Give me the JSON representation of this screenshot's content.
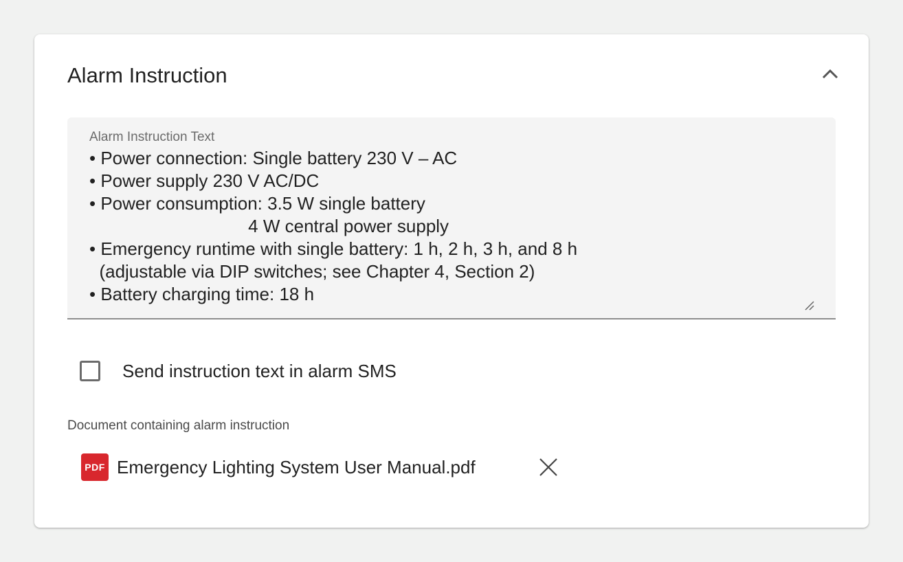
{
  "card": {
    "title": "Alarm Instruction",
    "collapse_icon": "chevron-up-icon"
  },
  "instruction": {
    "label": "Alarm Instruction Text",
    "lines": [
      "• Power connection: Single battery 230 V – AC",
      "• Power supply 230 V AC/DC",
      "• Power consumption: 3.5 W single battery",
      "                                4 W central power supply",
      "• Emergency runtime with single battery: 1 h, 2 h, 3 h, and 8 h",
      "  (adjustable via DIP switches; see Chapter 4, Section 2)",
      "• Battery charging time: 18 h"
    ],
    "resize_icon": "resize-handle-icon"
  },
  "sms_option": {
    "label": "Send instruction text in alarm SMS",
    "checked": false
  },
  "document": {
    "label": "Document containing alarm instruction",
    "file_icon_text": "PDF",
    "file_name": "Emergency Lighting System User Manual.pdf",
    "remove_icon": "close-icon"
  },
  "colors": {
    "pdf_icon": "#d8272d",
    "page_background": "#f1f2f1",
    "field_background": "#f4f4f4"
  }
}
